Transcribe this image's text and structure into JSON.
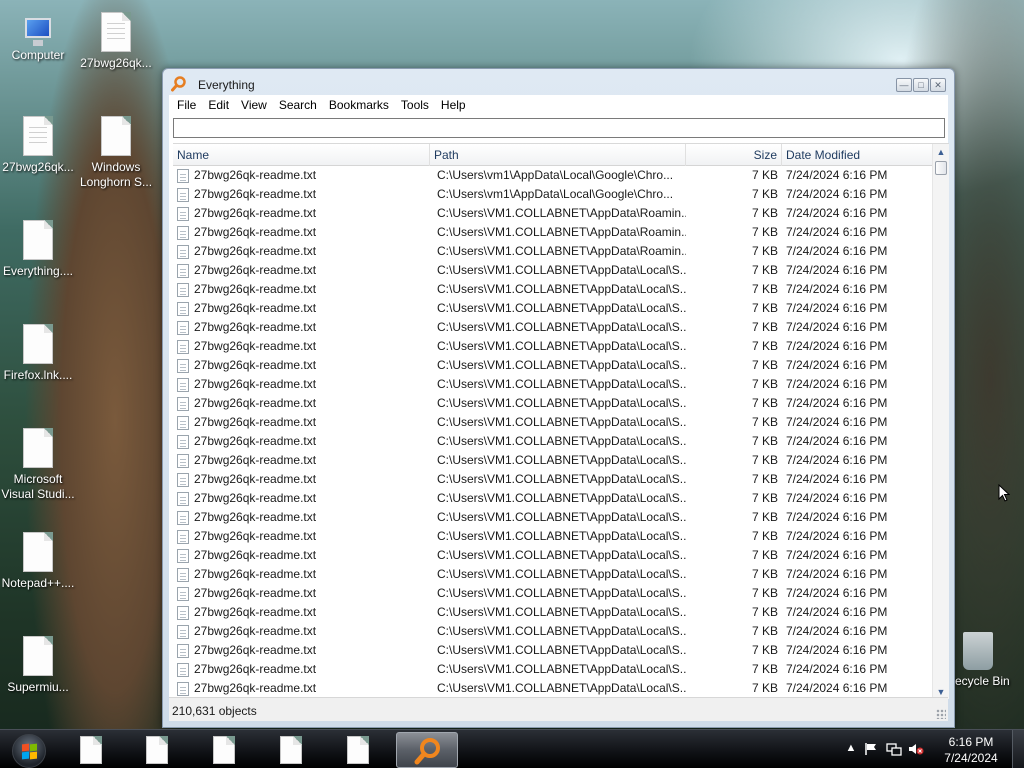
{
  "desktop": {
    "icons": [
      {
        "label": "Computer",
        "kind": "computer"
      },
      {
        "label": "27bwg26qk...",
        "kind": "doc"
      },
      {
        "label": "27bwg26qk...",
        "kind": "doc"
      },
      {
        "label": "Windows Longhorn S...",
        "kind": "doc"
      },
      {
        "label": "Everything....",
        "kind": "doc"
      },
      {
        "label": "Firefox.lnk....",
        "kind": "doc"
      },
      {
        "label": "Microsoft Visual Studi...",
        "kind": "doc"
      },
      {
        "label": "Notepad++....",
        "kind": "doc"
      },
      {
        "label": "Supermiu...",
        "kind": "doc"
      },
      {
        "label": "Recycle Bin",
        "kind": "recycle-bin"
      }
    ]
  },
  "window": {
    "title": "Everything",
    "menu": [
      "File",
      "Edit",
      "View",
      "Search",
      "Bookmarks",
      "Tools",
      "Help"
    ],
    "search": {
      "value": "",
      "placeholder": ""
    },
    "columns": {
      "name": "Name",
      "path": "Path",
      "size": "Size",
      "date": "Date Modified"
    },
    "rows": [
      {
        "name": "27bwg26qk-readme.txt",
        "path": "C:\\Users\\vm1\\AppData\\Local\\Google\\Chro...",
        "size": "7 KB",
        "date": "7/24/2024 6:16 PM"
      },
      {
        "name": "27bwg26qk-readme.txt",
        "path": "C:\\Users\\vm1\\AppData\\Local\\Google\\Chro...",
        "size": "7 KB",
        "date": "7/24/2024 6:16 PM"
      },
      {
        "name": "27bwg26qk-readme.txt",
        "path": "C:\\Users\\VM1.COLLABNET\\AppData\\Roamin...",
        "size": "7 KB",
        "date": "7/24/2024 6:16 PM"
      },
      {
        "name": "27bwg26qk-readme.txt",
        "path": "C:\\Users\\VM1.COLLABNET\\AppData\\Roamin...",
        "size": "7 KB",
        "date": "7/24/2024 6:16 PM"
      },
      {
        "name": "27bwg26qk-readme.txt",
        "path": "C:\\Users\\VM1.COLLABNET\\AppData\\Roamin...",
        "size": "7 KB",
        "date": "7/24/2024 6:16 PM"
      },
      {
        "name": "27bwg26qk-readme.txt",
        "path": "C:\\Users\\VM1.COLLABNET\\AppData\\Local\\S...",
        "size": "7 KB",
        "date": "7/24/2024 6:16 PM"
      },
      {
        "name": "27bwg26qk-readme.txt",
        "path": "C:\\Users\\VM1.COLLABNET\\AppData\\Local\\S...",
        "size": "7 KB",
        "date": "7/24/2024 6:16 PM"
      },
      {
        "name": "27bwg26qk-readme.txt",
        "path": "C:\\Users\\VM1.COLLABNET\\AppData\\Local\\S...",
        "size": "7 KB",
        "date": "7/24/2024 6:16 PM"
      },
      {
        "name": "27bwg26qk-readme.txt",
        "path": "C:\\Users\\VM1.COLLABNET\\AppData\\Local\\S...",
        "size": "7 KB",
        "date": "7/24/2024 6:16 PM"
      },
      {
        "name": "27bwg26qk-readme.txt",
        "path": "C:\\Users\\VM1.COLLABNET\\AppData\\Local\\S...",
        "size": "7 KB",
        "date": "7/24/2024 6:16 PM"
      },
      {
        "name": "27bwg26qk-readme.txt",
        "path": "C:\\Users\\VM1.COLLABNET\\AppData\\Local\\S...",
        "size": "7 KB",
        "date": "7/24/2024 6:16 PM"
      },
      {
        "name": "27bwg26qk-readme.txt",
        "path": "C:\\Users\\VM1.COLLABNET\\AppData\\Local\\S...",
        "size": "7 KB",
        "date": "7/24/2024 6:16 PM"
      },
      {
        "name": "27bwg26qk-readme.txt",
        "path": "C:\\Users\\VM1.COLLABNET\\AppData\\Local\\S...",
        "size": "7 KB",
        "date": "7/24/2024 6:16 PM"
      },
      {
        "name": "27bwg26qk-readme.txt",
        "path": "C:\\Users\\VM1.COLLABNET\\AppData\\Local\\S...",
        "size": "7 KB",
        "date": "7/24/2024 6:16 PM"
      },
      {
        "name": "27bwg26qk-readme.txt",
        "path": "C:\\Users\\VM1.COLLABNET\\AppData\\Local\\S...",
        "size": "7 KB",
        "date": "7/24/2024 6:16 PM"
      },
      {
        "name": "27bwg26qk-readme.txt",
        "path": "C:\\Users\\VM1.COLLABNET\\AppData\\Local\\S...",
        "size": "7 KB",
        "date": "7/24/2024 6:16 PM"
      },
      {
        "name": "27bwg26qk-readme.txt",
        "path": "C:\\Users\\VM1.COLLABNET\\AppData\\Local\\S...",
        "size": "7 KB",
        "date": "7/24/2024 6:16 PM"
      },
      {
        "name": "27bwg26qk-readme.txt",
        "path": "C:\\Users\\VM1.COLLABNET\\AppData\\Local\\S...",
        "size": "7 KB",
        "date": "7/24/2024 6:16 PM"
      },
      {
        "name": "27bwg26qk-readme.txt",
        "path": "C:\\Users\\VM1.COLLABNET\\AppData\\Local\\S...",
        "size": "7 KB",
        "date": "7/24/2024 6:16 PM"
      },
      {
        "name": "27bwg26qk-readme.txt",
        "path": "C:\\Users\\VM1.COLLABNET\\AppData\\Local\\S...",
        "size": "7 KB",
        "date": "7/24/2024 6:16 PM"
      },
      {
        "name": "27bwg26qk-readme.txt",
        "path": "C:\\Users\\VM1.COLLABNET\\AppData\\Local\\S...",
        "size": "7 KB",
        "date": "7/24/2024 6:16 PM"
      },
      {
        "name": "27bwg26qk-readme.txt",
        "path": "C:\\Users\\VM1.COLLABNET\\AppData\\Local\\S...",
        "size": "7 KB",
        "date": "7/24/2024 6:16 PM"
      },
      {
        "name": "27bwg26qk-readme.txt",
        "path": "C:\\Users\\VM1.COLLABNET\\AppData\\Local\\S...",
        "size": "7 KB",
        "date": "7/24/2024 6:16 PM"
      },
      {
        "name": "27bwg26qk-readme.txt",
        "path": "C:\\Users\\VM1.COLLABNET\\AppData\\Local\\S...",
        "size": "7 KB",
        "date": "7/24/2024 6:16 PM"
      },
      {
        "name": "27bwg26qk-readme.txt",
        "path": "C:\\Users\\VM1.COLLABNET\\AppData\\Local\\S...",
        "size": "7 KB",
        "date": "7/24/2024 6:16 PM"
      },
      {
        "name": "27bwg26qk-readme.txt",
        "path": "C:\\Users\\VM1.COLLABNET\\AppData\\Local\\S...",
        "size": "7 KB",
        "date": "7/24/2024 6:16 PM"
      },
      {
        "name": "27bwg26qk-readme.txt",
        "path": "C:\\Users\\VM1.COLLABNET\\AppData\\Local\\S...",
        "size": "7 KB",
        "date": "7/24/2024 6:16 PM"
      },
      {
        "name": "27bwg26qk-readme.txt",
        "path": "C:\\Users\\VM1.COLLABNET\\AppData\\Local\\S...",
        "size": "7 KB",
        "date": "7/24/2024 6:16 PM"
      }
    ],
    "status": "210,631 objects"
  },
  "taskbar": {
    "pinned": [
      "doc",
      "doc",
      "doc",
      "doc",
      "doc",
      "everything"
    ],
    "active_app": "Everything",
    "tray_icons": [
      "show-hidden-icons",
      "action-center-flag-icon",
      "network-icon",
      "volume-muted-icon"
    ],
    "clock": {
      "time": "6:16 PM",
      "date": "7/24/2024"
    }
  },
  "colors": {
    "accent_orange": "#e67e22",
    "header_text": "#1e3a5f",
    "window_frame": "#cfdce9"
  }
}
